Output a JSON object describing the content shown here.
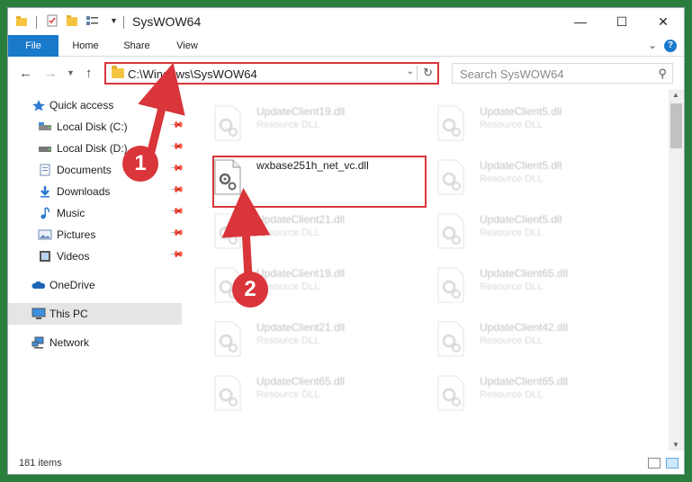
{
  "window": {
    "title": "SysWOW64",
    "minimize_glyph": "—",
    "maximize_glyph": "☐",
    "close_glyph": "✕"
  },
  "ribbon": {
    "tabs": [
      "File",
      "Home",
      "Share",
      "View"
    ],
    "help_label": "?"
  },
  "navigation": {
    "back_glyph": "←",
    "forward_glyph": "→",
    "up_glyph": "↑",
    "address": "C:\\Windows\\SysWOW64",
    "search_placeholder": "Search SysWOW64"
  },
  "sidebar": {
    "items": [
      {
        "label": "Quick access",
        "icon": "star-icon",
        "pinned": false
      },
      {
        "label": "Local Disk (C:)",
        "icon": "drive-icon",
        "pinned": true
      },
      {
        "label": "Local Disk (D:)",
        "icon": "drive-icon",
        "pinned": true
      },
      {
        "label": "Documents",
        "icon": "documents-icon",
        "pinned": true
      },
      {
        "label": "Downloads",
        "icon": "download-icon",
        "pinned": true
      },
      {
        "label": "Music",
        "icon": "music-icon",
        "pinned": true
      },
      {
        "label": "Pictures",
        "icon": "pictures-icon",
        "pinned": true
      },
      {
        "label": "Videos",
        "icon": "videos-icon",
        "pinned": true
      },
      {
        "label": "OneDrive",
        "icon": "cloud-icon",
        "pinned": false
      },
      {
        "label": "This PC",
        "icon": "computer-icon",
        "pinned": false,
        "selected": true
      },
      {
        "label": "Network",
        "icon": "network-icon",
        "pinned": false
      }
    ]
  },
  "files": {
    "left_column": [
      {
        "name": "UpdateClient19.dll",
        "type": "Resource DLL"
      },
      {
        "name": "wxbase251h_net_vc.dll",
        "type": ""
      },
      {
        "name": "UpdateClient21.dll",
        "type": "Resource DLL"
      },
      {
        "name": "UpdateClient19.dll",
        "type": "Resource DLL"
      },
      {
        "name": "UpdateClient21.dll",
        "type": "Resource DLL"
      },
      {
        "name": "UpdateClient65.dll",
        "type": "Resource DLL"
      }
    ],
    "right_column": [
      {
        "name": "UpdateClient5.dll",
        "type": "Resource DLL"
      },
      {
        "name": "UpdateClient5.dll",
        "type": "Resource DLL"
      },
      {
        "name": "UpdateClient5.dll",
        "type": "Resource DLL"
      },
      {
        "name": "UpdateClient65.dll",
        "type": "Resource DLL"
      },
      {
        "name": "UpdateClient42.dll",
        "type": "Resource DLL"
      },
      {
        "name": "UpdateClient65.dll",
        "type": "Resource DLL"
      }
    ]
  },
  "status": {
    "item_count": "181 items"
  },
  "annotations": {
    "step1": "1",
    "step2": "2",
    "accent_color": "#d9353b"
  }
}
